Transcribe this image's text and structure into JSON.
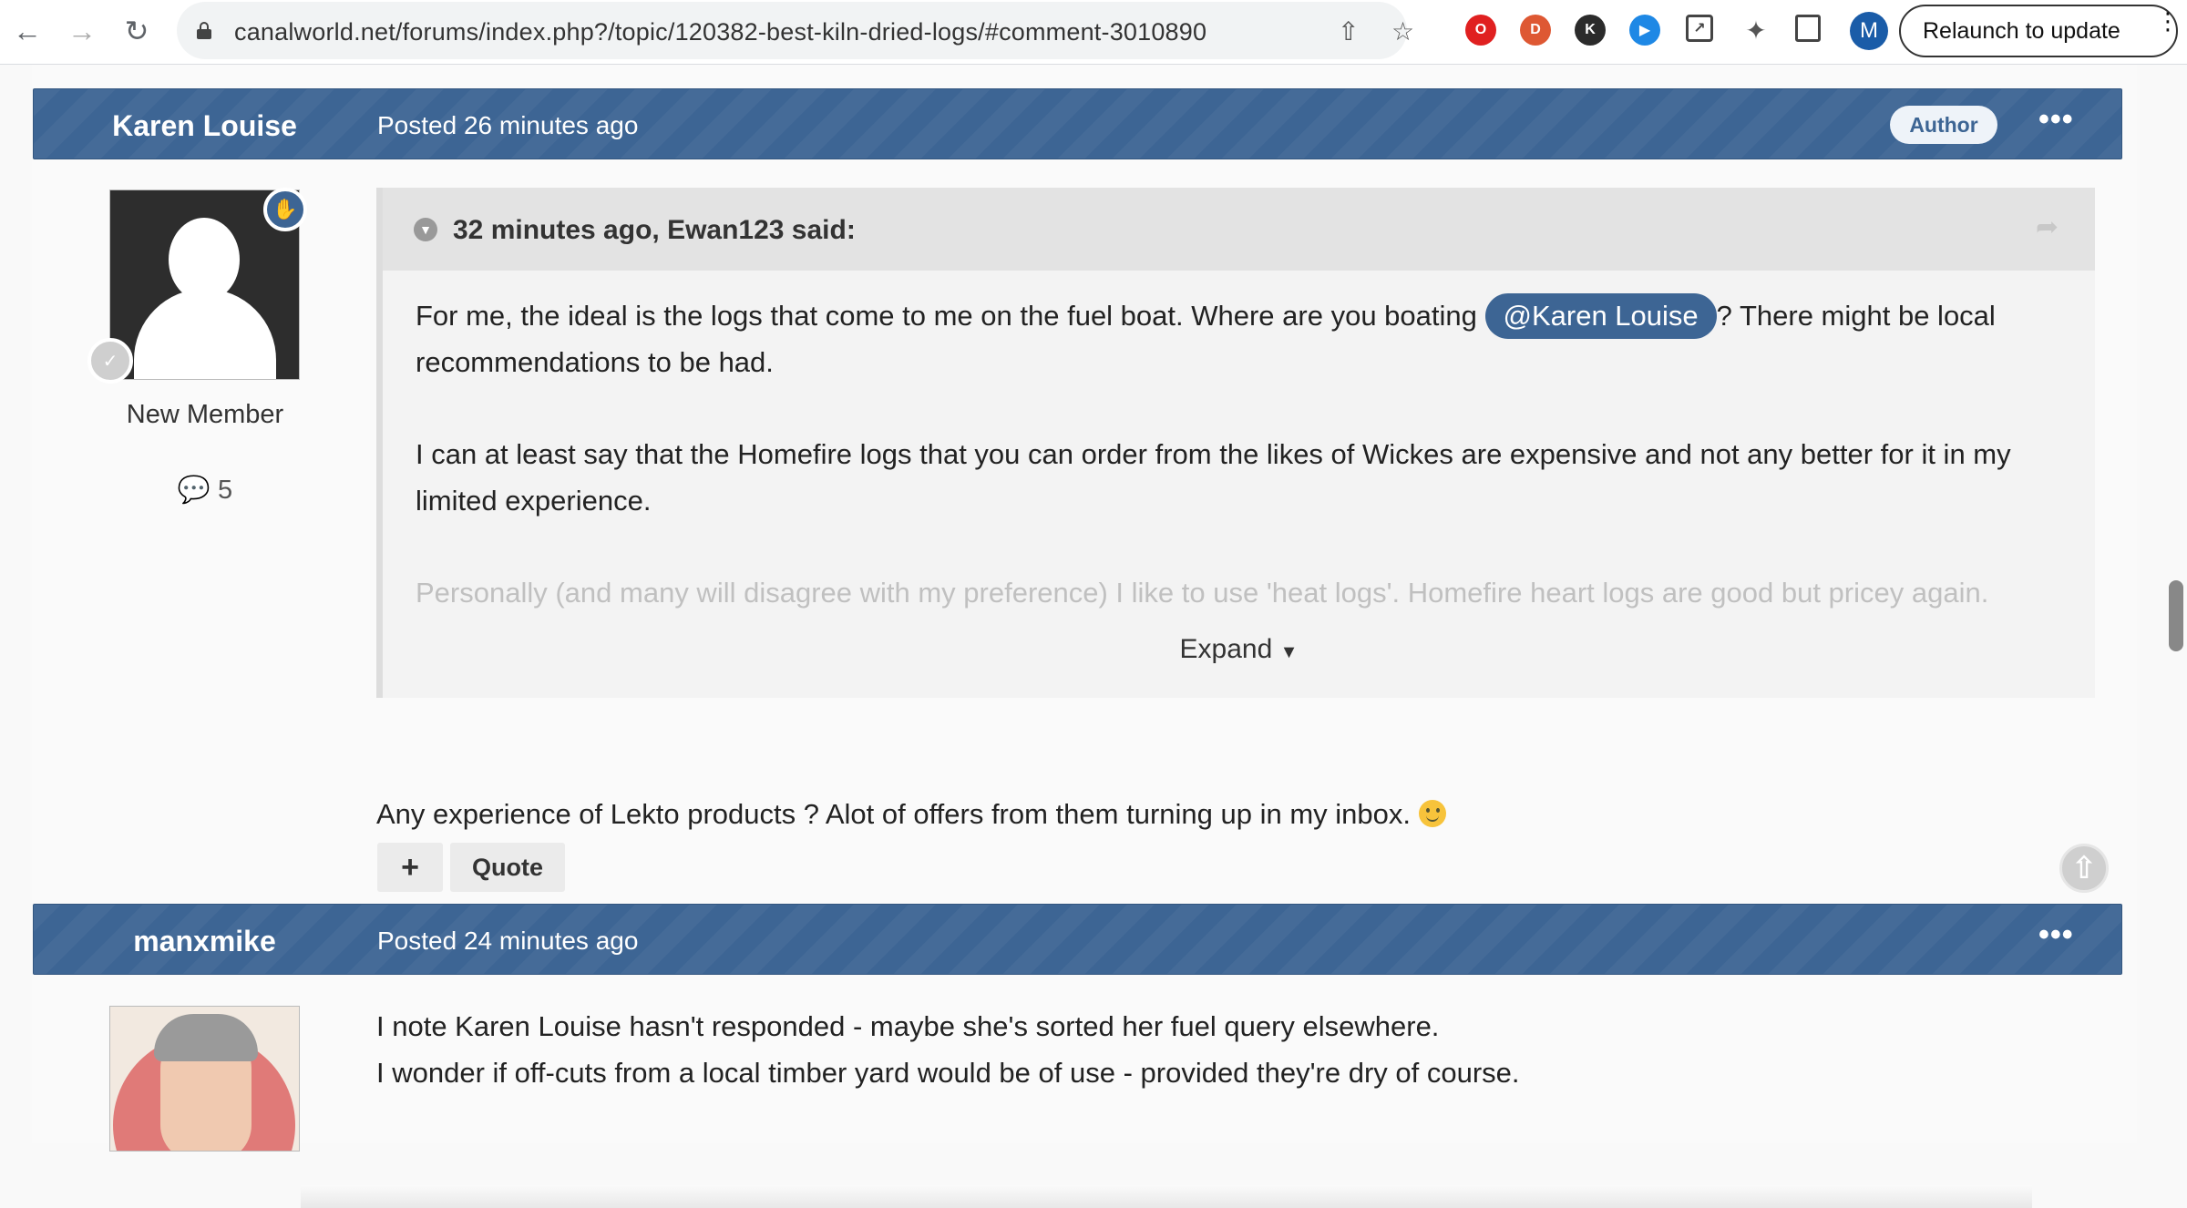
{
  "browser": {
    "url": "canalworld.net/forums/index.php?/topic/120382-best-kiln-dried-logs/#comment-3010890",
    "profile_initial": "M",
    "relaunch_label": "Relaunch to update",
    "icons": [
      "back-icon",
      "forward-icon",
      "reload-icon",
      "lock-icon",
      "share-icon",
      "star-icon",
      "extensions-icon",
      "sidepanel-icon"
    ]
  },
  "posts": [
    {
      "author": "Karen Louise",
      "posted_label": "Posted",
      "posted_time": "26 minutes ago",
      "badge": "Author",
      "member_title": "New Member",
      "post_count": "5",
      "quote": {
        "cite": "32 minutes ago, Ewan123 said:",
        "p1_before": "For me, the ideal is the logs that come to me on the fuel boat. Where are you boating ",
        "mention": "@Karen Louise",
        "p1_after": "? There might be local recommendations to be had.",
        "p2": "I can at least say that the Homefire logs that you can order from the likes of Wickes are expensive and not any better for it in my limited experience.",
        "p3": "Personally (and many will disagree with my preference) I like to use 'heat logs'. Homefire heart logs are good but pricey again.",
        "expand_label": "Expand"
      },
      "body": "Any experience of Lekto products ? Alot of offers from them turning up in my inbox. ",
      "plus_label": "+",
      "quote_label": "Quote"
    },
    {
      "author": "manxmike",
      "posted_label": "Posted",
      "posted_time": "24 minutes ago",
      "body_line1": "I note Karen Louise hasn't responded - maybe she's sorted her fuel query elsewhere.",
      "body_line2": "I wonder if off-cuts from a local timber yard would be of use - provided they're dry of course."
    }
  ],
  "colors": {
    "header_blue": "#3d6594",
    "page_bg": "#f9f9f9"
  }
}
